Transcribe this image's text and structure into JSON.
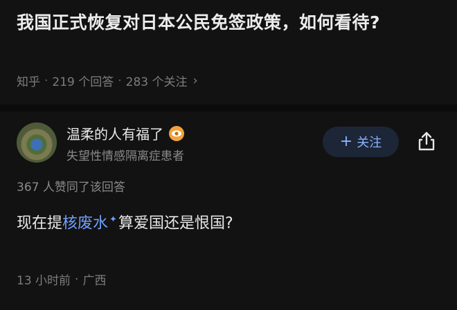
{
  "question": {
    "title": "我国正式恢复对日本公民免签政策，如何看待?"
  },
  "meta": {
    "source": "知乎",
    "answers": "219 个回答",
    "followers": "283 个关注",
    "separator": "·"
  },
  "author": {
    "name": "温柔的人有福了",
    "bio": "失望性情感隔离症患者",
    "badge_icon": "eye-badge-icon"
  },
  "follow": {
    "label": "关注",
    "plus": "+"
  },
  "likes_text": "367 人赞同了该回答",
  "answer": {
    "text_before": "现在提",
    "link_text": "核废水",
    "text_after": "算爱国还是恨国?"
  },
  "footer": {
    "time": "13 小时前",
    "location": "广西",
    "separator": "·"
  },
  "colors": {
    "background": "#121212",
    "accent": "#6ea0ff",
    "muted": "#7d7d7d"
  }
}
